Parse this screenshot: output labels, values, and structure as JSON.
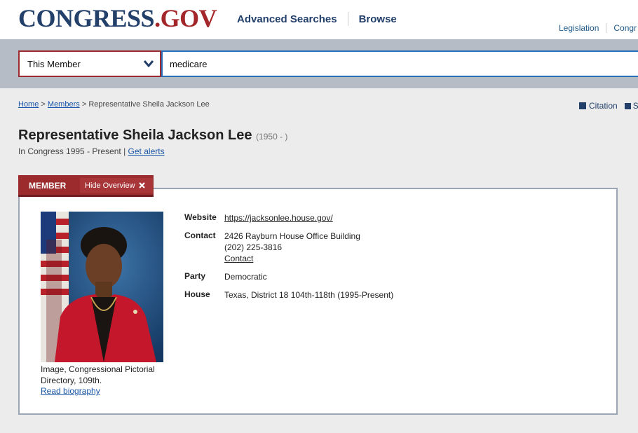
{
  "header": {
    "logo_prefix": "CONGRESS",
    "logo_dot": ".",
    "logo_suffix": "GOV",
    "nav": [
      "Advanced Searches",
      "Browse"
    ],
    "subnav": [
      "Legislation",
      "Congr"
    ]
  },
  "search": {
    "scope": "This Member",
    "query": "medicare"
  },
  "breadcrumb": {
    "home": "Home",
    "sep1": ">",
    "members": "Members",
    "sep2": ">",
    "current": "Representative Sheila Jackson Lee"
  },
  "tools": {
    "citation": "Citation",
    "share": "S"
  },
  "member": {
    "name": "Representative Sheila Jackson Lee",
    "dates": "(1950 - )",
    "tenure": "In Congress 1995 - Present |",
    "alerts": "Get alerts"
  },
  "tab": {
    "label": "MEMBER",
    "hide": "Hide Overview"
  },
  "photo_caption": "Image, Congressional Pictorial Directory, 109th.",
  "read_bio": "Read biography",
  "details": {
    "website_label": "Website",
    "website": "https://jacksonlee.house.gov/",
    "contact_label": "Contact",
    "address": "2426 Rayburn House Office Building",
    "phone": "(202) 225-3816",
    "contact_link": "Contact",
    "party_label": "Party",
    "party": "Democratic",
    "house_label": "House",
    "house": "Texas, District 18 104th-118th (1995-Present)"
  },
  "colors": {
    "brand_navy": "#23406b",
    "brand_red": "#9c2b2e",
    "link": "#1a56a8"
  }
}
